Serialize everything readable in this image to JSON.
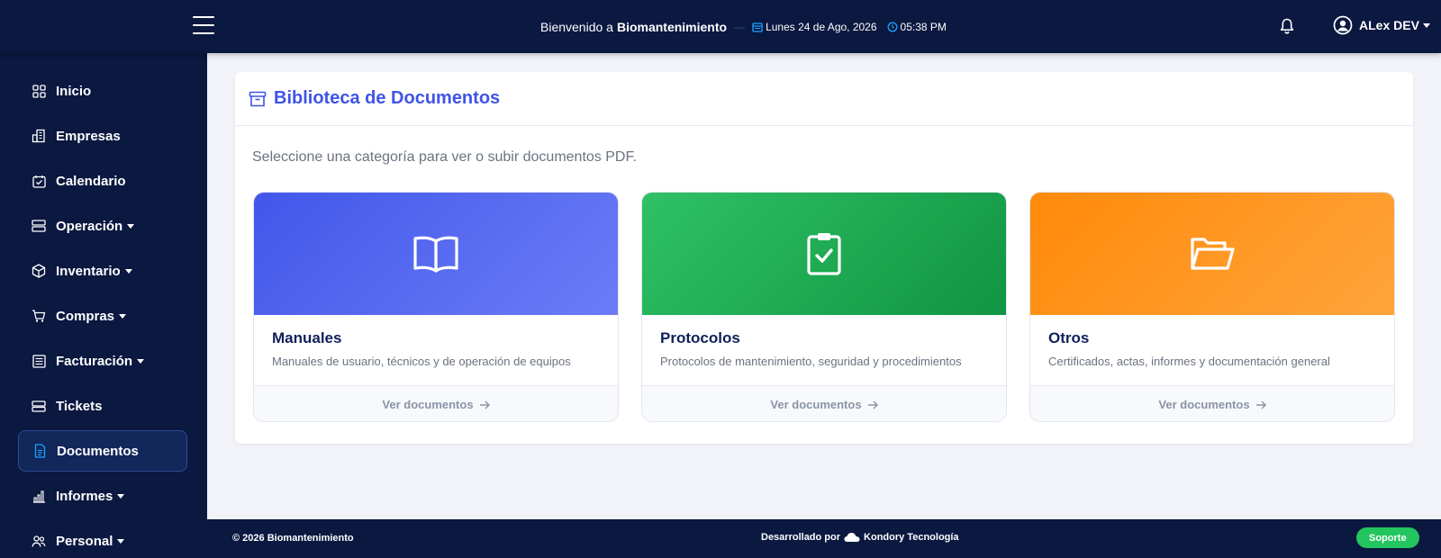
{
  "header": {
    "welcome_prefix": "Bienvenido a",
    "brand": "Biomantenimiento",
    "separator": "—",
    "date": "Lunes 24 de Ago, 2026",
    "time": "05:38 PM",
    "user_name": "ALex DEV"
  },
  "sidebar": {
    "items": [
      {
        "label": "Inicio",
        "icon": "grid-icon"
      },
      {
        "label": "Empresas",
        "icon": "building-icon"
      },
      {
        "label": "Calendario",
        "icon": "calendar-check-icon"
      },
      {
        "label": "Operación",
        "icon": "server-icon",
        "dropdown": true
      },
      {
        "label": "Inventario",
        "icon": "box-icon",
        "dropdown": true
      },
      {
        "label": "Compras",
        "icon": "cart-icon",
        "dropdown": true
      },
      {
        "label": "Facturación",
        "icon": "receipt-icon",
        "dropdown": true
      },
      {
        "label": "Tickets",
        "icon": "ticket-icon"
      },
      {
        "label": "Documentos",
        "icon": "file-text-icon",
        "active": true
      },
      {
        "label": "Informes",
        "icon": "bar-chart-icon",
        "dropdown": true
      },
      {
        "label": "Personal",
        "icon": "people-icon",
        "dropdown": true
      }
    ]
  },
  "main": {
    "title": "Biblioteca de Documentos",
    "subtitle": "Seleccione una categoría para ver o subir documentos PDF.",
    "categories": [
      {
        "title": "Manuales",
        "description": "Manuales de usuario, técnicos y de operación de equipos",
        "link": "Ver documentos",
        "icon": "book-icon",
        "color": "#4a5cf0"
      },
      {
        "title": "Protocolos",
        "description": "Protocolos de mantenimiento, seguridad y procedimientos",
        "link": "Ver documentos",
        "icon": "clipboard-check-icon",
        "color": "#22b35b"
      },
      {
        "title": "Otros",
        "description": "Certificados, actas, informes y documentación general",
        "link": "Ver documentos",
        "icon": "folder-open-icon",
        "color": "#ff951f"
      }
    ]
  },
  "footer": {
    "copyright": "© 2026 Biomantenimiento",
    "developed_by": "Desarrollado por",
    "company": "Kondory Tecnología",
    "support": "Soporte"
  },
  "colors": {
    "navy": "#0b1840",
    "accent": "#3f54e6",
    "support_green": "#22c55e"
  }
}
